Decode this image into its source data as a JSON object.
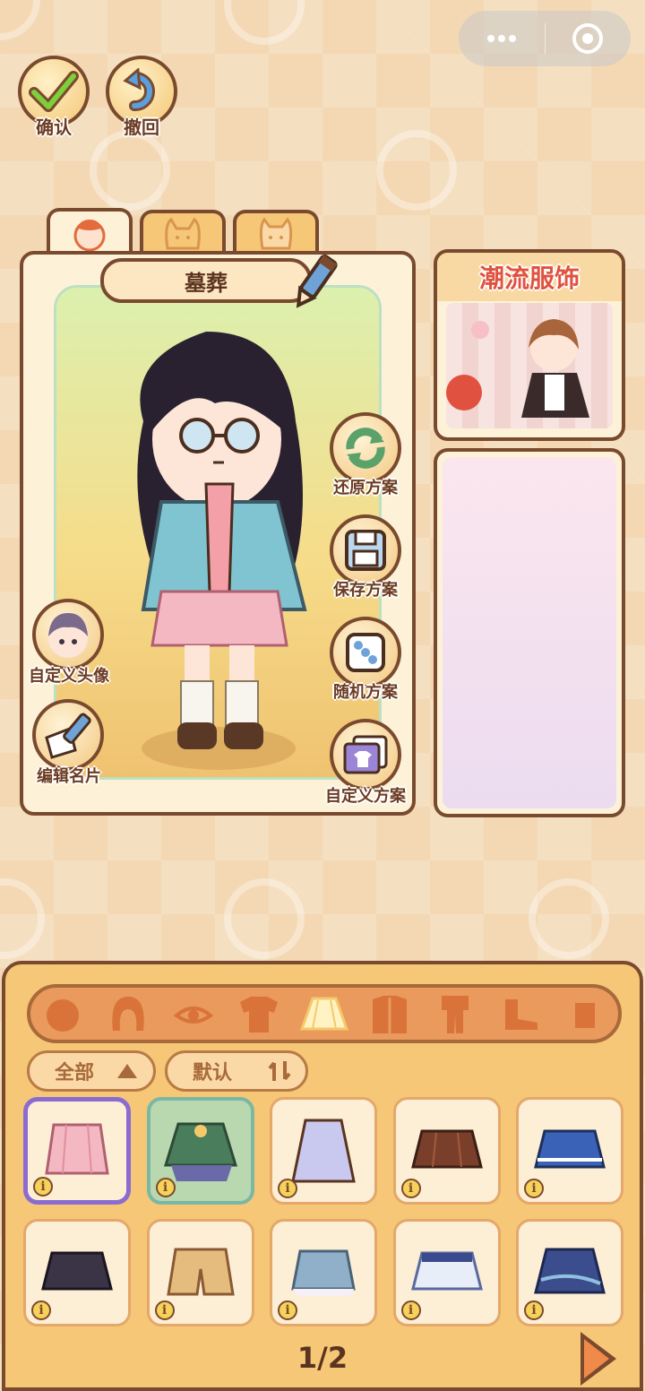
{
  "top_buttons": {
    "confirm_label": "确认",
    "undo_label": "撤回"
  },
  "capsule": {
    "more_icon": "dots-icon",
    "close_icon": "target-icon"
  },
  "character": {
    "name": "墓葬"
  },
  "tabs": [
    {
      "icon": "girl-face-icon",
      "active": true
    },
    {
      "icon": "cat-face-icon",
      "active": false
    },
    {
      "icon": "dog-face-icon",
      "active": false
    }
  ],
  "side_actions": {
    "restore": "还原方案",
    "save": "保存方案",
    "random": "随机方案",
    "custom": "自定义方案",
    "custom_avatar": "自定义头像",
    "edit_card": "编辑名片"
  },
  "promo": {
    "title": "潮流服饰"
  },
  "categories": [
    "face",
    "hair",
    "eye",
    "top",
    "skirt",
    "coat",
    "suit",
    "shoes",
    "accessory"
  ],
  "active_category": "skirt",
  "filters": {
    "category": "全部",
    "sort": "默认"
  },
  "items": [
    {
      "kind": "pink-plaid-skirt",
      "color": "#f0a5b0",
      "selected": true
    },
    {
      "kind": "green-layered-skirt",
      "color": "#4a7d5b",
      "selected": false
    },
    {
      "kind": "lavender-long-skirt",
      "color": "#c9c8ef",
      "selected": false
    },
    {
      "kind": "brown-pleated-skirt",
      "color": "#7a3f2a",
      "selected": false
    },
    {
      "kind": "blue-pleated-skirt",
      "color": "#3a63b8",
      "selected": false
    },
    {
      "kind": "black-pleated-skirt",
      "color": "#3b3446",
      "selected": false
    },
    {
      "kind": "tan-shorts",
      "color": "#e6bc7e",
      "selected": false
    },
    {
      "kind": "denim-skirt",
      "color": "#8fb0c8",
      "selected": false
    },
    {
      "kind": "white-blue-skirt",
      "color": "#e8eef8",
      "selected": false
    },
    {
      "kind": "navy-print-skirt",
      "color": "#3b4d8c",
      "selected": false
    }
  ],
  "info_glyph": "i",
  "pagination": {
    "label": "1/2"
  }
}
